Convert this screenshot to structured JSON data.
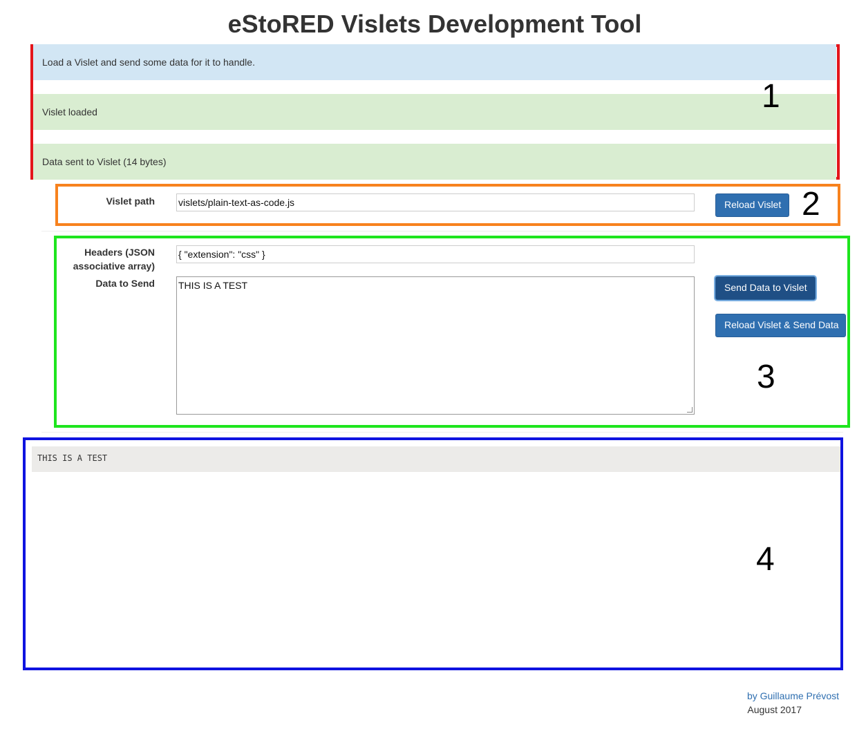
{
  "header": {
    "title": "eStoRED Vislets Development Tool"
  },
  "annotations": {
    "region1": {
      "number": "1",
      "color": "#e4151b"
    },
    "region2": {
      "number": "2",
      "color": "#f7821e"
    },
    "region3": {
      "number": "3",
      "color": "#1ee51e"
    },
    "region4": {
      "number": "4",
      "color": "#0f13e0"
    }
  },
  "alerts": [
    {
      "text": "Load a Vislet and send some data for it to handle.",
      "type": "info"
    },
    {
      "text": "Vislet loaded",
      "type": "success"
    },
    {
      "text": "Data sent to Vislet (14 bytes)",
      "type": "success"
    }
  ],
  "vislet_form": {
    "path_label": "Vislet path",
    "path_value": "vislets/plain-text-as-code.js",
    "reload_button": "Reload Vislet"
  },
  "data_form": {
    "headers_label_line1": "Headers (JSON",
    "headers_label_line2": "associative array)",
    "headers_value": "{ \"extension\": \"css\" }",
    "data_label": "Data to Send",
    "data_value": "THIS IS A TEST",
    "send_button": "Send Data to Vislet",
    "reload_send_button": "Reload Vislet & Send Data"
  },
  "output": {
    "code": "THIS IS A TEST"
  },
  "footer": {
    "author": "by Guillaume Prévost",
    "date": "August 2017"
  },
  "colors": {
    "primary_button": "#2f6fb0",
    "info_bg": "#d2e6f4",
    "success_bg": "#d9edd1"
  }
}
